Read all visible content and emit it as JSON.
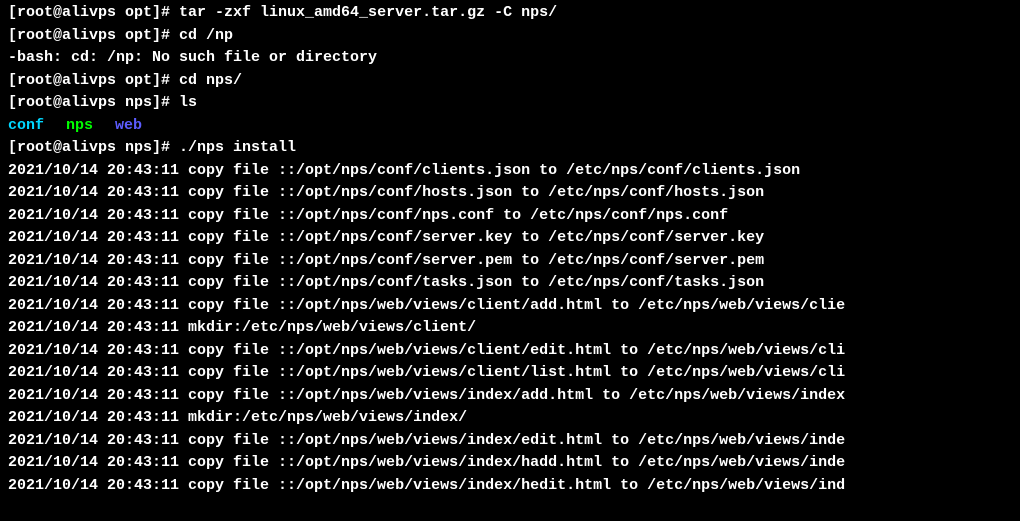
{
  "lines": {
    "l1_prompt": "[root@alivps opt]# ",
    "l1_cmd": "tar -zxf linux_amd64_server.tar.gz -C nps/",
    "l2_prompt": "[root@alivps opt]# ",
    "l2_cmd": "cd /np",
    "l3": "-bash: cd: /np: No such file or directory",
    "l4_prompt": "[root@alivps opt]# ",
    "l4_cmd": "cd nps/",
    "l5_prompt": "[root@alivps nps]# ",
    "l5_cmd": "ls",
    "dir_conf": "conf",
    "dir_nps": "nps",
    "dir_web": "web",
    "l7_prompt": "[root@alivps nps]# ",
    "l7_cmd": "./nps install",
    "o1": "2021/10/14 20:43:11 copy file ::/opt/nps/conf/clients.json to /etc/nps/conf/clients.json",
    "o2": "2021/10/14 20:43:11 copy file ::/opt/nps/conf/hosts.json to /etc/nps/conf/hosts.json",
    "o3": "2021/10/14 20:43:11 copy file ::/opt/nps/conf/nps.conf to /etc/nps/conf/nps.conf",
    "o4": "2021/10/14 20:43:11 copy file ::/opt/nps/conf/server.key to /etc/nps/conf/server.key",
    "o5": "2021/10/14 20:43:11 copy file ::/opt/nps/conf/server.pem to /etc/nps/conf/server.pem",
    "o6": "2021/10/14 20:43:11 copy file ::/opt/nps/conf/tasks.json to /etc/nps/conf/tasks.json",
    "o7": "2021/10/14 20:43:11 copy file ::/opt/nps/web/views/client/add.html to /etc/nps/web/views/clie",
    "o8": "2021/10/14 20:43:11 mkdir:/etc/nps/web/views/client/",
    "o9": "2021/10/14 20:43:11 copy file ::/opt/nps/web/views/client/edit.html to /etc/nps/web/views/cli",
    "o10": "2021/10/14 20:43:11 copy file ::/opt/nps/web/views/client/list.html to /etc/nps/web/views/cli",
    "o11": "2021/10/14 20:43:11 copy file ::/opt/nps/web/views/index/add.html to /etc/nps/web/views/index",
    "o12": "2021/10/14 20:43:11 mkdir:/etc/nps/web/views/index/",
    "o13": "2021/10/14 20:43:11 copy file ::/opt/nps/web/views/index/edit.html to /etc/nps/web/views/inde",
    "o14": "2021/10/14 20:43:11 copy file ::/opt/nps/web/views/index/hadd.html to /etc/nps/web/views/inde",
    "o15": "2021/10/14 20:43:11 copy file ::/opt/nps/web/views/index/hedit.html to /etc/nps/web/views/ind"
  }
}
